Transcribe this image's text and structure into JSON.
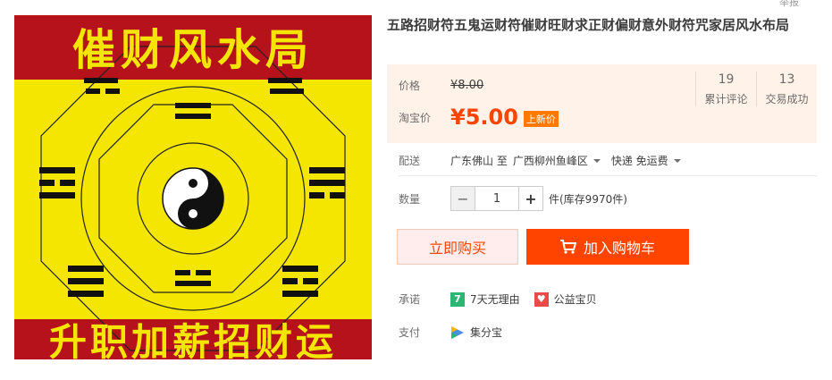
{
  "report_link": "举报",
  "product": {
    "title": "五路招财符五鬼运财符催财旺财求正财偏财意外财符咒家居风水布局",
    "image_banner_top": "催财风水局",
    "image_banner_bottom": "升职加薪招财运"
  },
  "price": {
    "original_label": "价格",
    "original_value": "¥8.00",
    "promo_label": "淘宝价",
    "promo_value": "¥5.00",
    "promo_badge": "上新价"
  },
  "stats": [
    {
      "num": "19",
      "label": "累计评论"
    },
    {
      "num": "13",
      "label": "交易成功"
    }
  ],
  "shipping": {
    "label": "配送",
    "from": "广东佛山 至",
    "to": "广西柳州鱼峰区",
    "method": "快递 免运费"
  },
  "quantity": {
    "label": "数量",
    "value": "1",
    "minus": "−",
    "plus": "+",
    "stock": "件(库存9970件)"
  },
  "buttons": {
    "buy_now": "立即购买",
    "add_to_cart": "加入购物车"
  },
  "promise": {
    "label": "承诺",
    "items": [
      {
        "icon": "7",
        "text": "7天无理由",
        "color": "#2bb673"
      },
      {
        "icon": "♥",
        "text": "公益宝贝",
        "color": "#e94b4b"
      }
    ]
  },
  "payment": {
    "label": "支付",
    "items": [
      {
        "text": "集分宝"
      }
    ]
  },
  "colors": {
    "accent": "#ff4400",
    "badge": "#ff7900",
    "price_bg": "#fff2e8",
    "image_red": "#b5121b",
    "image_yellow": "#f4e600"
  }
}
